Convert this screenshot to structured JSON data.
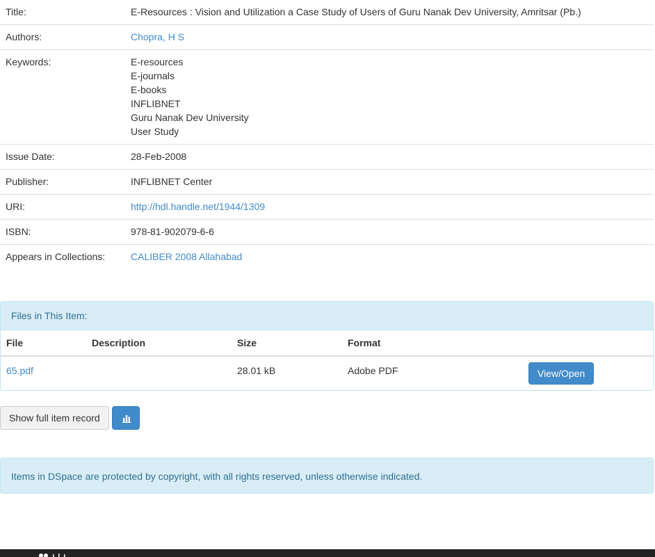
{
  "metadata": {
    "title_label": "Title:",
    "title_value": "E-Resources : Vision and Utilization a Case Study of Users of Guru Nanak Dev University, Amritsar (Pb.)",
    "authors_label": "Authors:",
    "authors_value": "Chopra, H S",
    "keywords_label": "Keywords:",
    "keywords": [
      "E-resources",
      "E-journals",
      "E-books",
      "INFLIBNET",
      "Guru Nanak Dev University",
      "User Study"
    ],
    "issue_date_label": "Issue Date:",
    "issue_date_value": "28-Feb-2008",
    "publisher_label": "Publisher:",
    "publisher_value": "INFLIBNET Center",
    "uri_label": "URI:",
    "uri_value": "http://hdl.handle.net/1944/1309",
    "isbn_label": "ISBN:",
    "isbn_value": "978-81-902079-6-6",
    "collections_label": "Appears in Collections:",
    "collections_value": "CALIBER 2008 Allahabad"
  },
  "files": {
    "heading": "Files in This Item:",
    "columns": {
      "file": "File",
      "description": "Description",
      "size": "Size",
      "format": "Format"
    },
    "rows": [
      {
        "file": "65.pdf",
        "description": "",
        "size": "28.01 kB",
        "format": "Adobe PDF",
        "action": "View/Open"
      }
    ]
  },
  "actions": {
    "show_full_record": "Show full item record",
    "stats_icon": "bar-chart-icon"
  },
  "notice": "Items in DSpace are protected by copyright, with all rights reserved, unless otherwise indicated.",
  "colors": {
    "link": "#428bca",
    "primary": "#428bca",
    "info_bg": "#d9edf7",
    "info_text": "#31708f",
    "footer_bg": "#222222"
  }
}
